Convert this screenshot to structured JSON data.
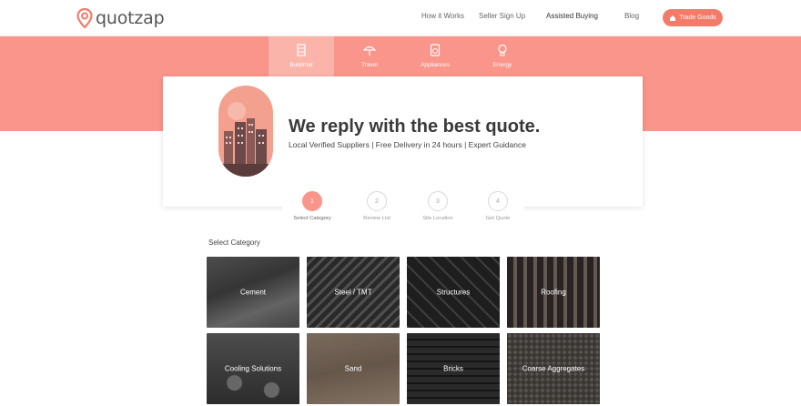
{
  "brand": {
    "name": "quotzap",
    "accent": "#f27b6a",
    "band": "#f9958a"
  },
  "nav": {
    "links": [
      "How it Works",
      "Seller Sign Up",
      "Assisted Buying",
      "Blog"
    ],
    "cta": "Trade Goods"
  },
  "tabs": [
    {
      "label": "Buildmat",
      "icon": "building-icon",
      "active": true
    },
    {
      "label": "Travel",
      "icon": "umbrella-icon",
      "active": false
    },
    {
      "label": "Appliances",
      "icon": "appliance-icon",
      "active": false
    },
    {
      "label": "Energy",
      "icon": "bulb-icon",
      "active": false
    }
  ],
  "hero": {
    "title": "We reply with the best quote.",
    "subtitle": "Local Verified Suppliers | Free Delivery in 24 hours | Expert Guidance"
  },
  "steps": [
    {
      "num": "1",
      "label": "Select Category",
      "active": true
    },
    {
      "num": "2",
      "label": "Review List",
      "active": false
    },
    {
      "num": "3",
      "label": "Site Location",
      "active": false
    },
    {
      "num": "4",
      "label": "Get Quote",
      "active": false
    }
  ],
  "categories_title": "Select Category",
  "categories": [
    {
      "label": "Cement"
    },
    {
      "label": "Steel / TMT"
    },
    {
      "label": "Structures"
    },
    {
      "label": "Roofing"
    },
    {
      "label": "Cooling Solutions"
    },
    {
      "label": "Sand"
    },
    {
      "label": "Bricks"
    },
    {
      "label": "Coarse Aggregates"
    }
  ]
}
